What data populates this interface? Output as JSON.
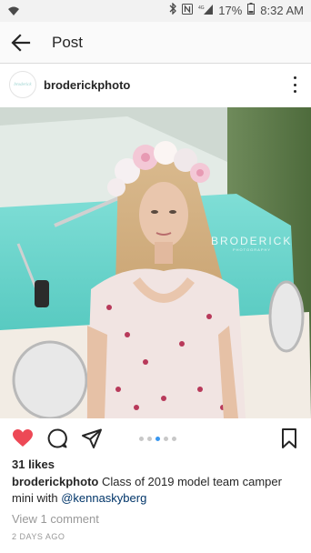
{
  "status_bar": {
    "battery_percent": "17%",
    "time": "8:32 AM",
    "signal_label": "4G"
  },
  "header": {
    "title": "Post"
  },
  "post": {
    "username": "broderickphoto",
    "avatar_text": "broderick",
    "watermark": "BRODERICK",
    "watermark_sub": "PHOTOGRAPHY",
    "likes": "31 likes",
    "caption_user": "broderickphoto",
    "caption_text": "Class of 2019 model team camper mini with ",
    "caption_mention": "@kennaskyberg",
    "view_comments": "View 1 comment",
    "time_ago": "2 DAYS AGO",
    "carousel": {
      "count": 5,
      "active_index": 2
    },
    "liked": true
  },
  "colors": {
    "like_red": "#ed4956",
    "carousel_active": "#3897f0",
    "mention": "#003569"
  }
}
